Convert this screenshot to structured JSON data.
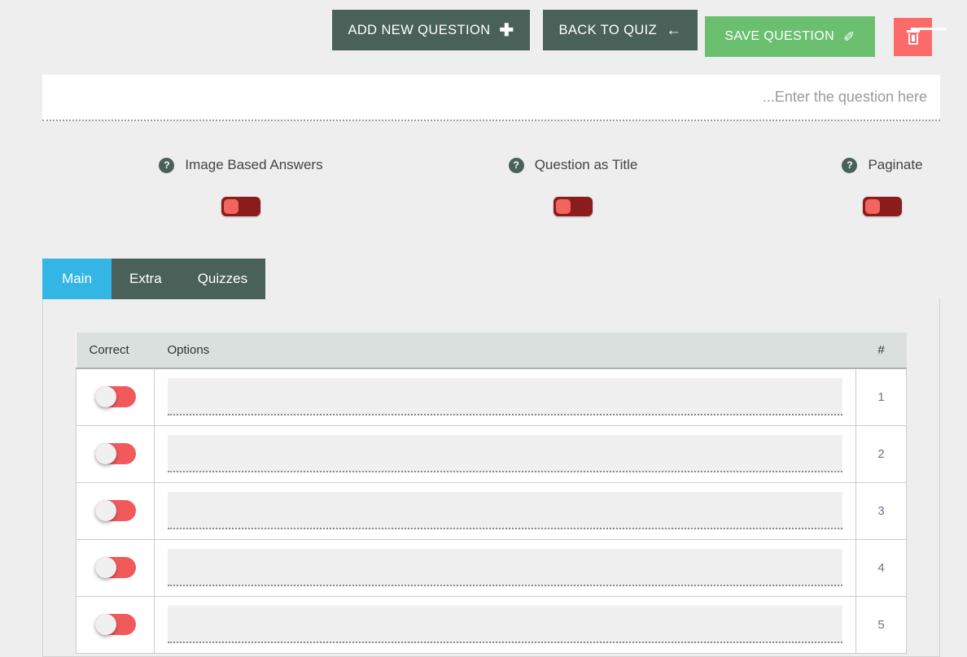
{
  "toolbar": {
    "add_new_question": {
      "label": "ADD NEW QUESTION",
      "icon": "plus-icon",
      "glyph": "✚",
      "color": "#4a615a"
    },
    "back_to_quiz": {
      "label": "BACK TO QUIZ",
      "icon": "arrow-left-icon",
      "glyph": "←",
      "color": "#4a615a"
    },
    "save_question": {
      "label": "SAVE QUESTION",
      "icon": "pin-icon",
      "glyph": "✐",
      "color": "#6bc070"
    },
    "delete_question": {
      "label": "",
      "icon": "trash-icon",
      "color": "#fc6a6a"
    }
  },
  "question": {
    "value": "",
    "placeholder": "...Enter the question here"
  },
  "switches": [
    {
      "label": "Image Based Answers",
      "help_icon": "question-mark-icon",
      "help_glyph": "?",
      "state": "off",
      "track_color": "#8a1c1c",
      "knob_color": "#f2655f"
    },
    {
      "label": "Question as Title",
      "help_icon": "question-mark-icon",
      "help_glyph": "?",
      "state": "off",
      "track_color": "#8a1c1c",
      "knob_color": "#f2655f"
    },
    {
      "label": "Paginate",
      "help_icon": "question-mark-icon",
      "help_glyph": "?",
      "state": "off",
      "track_color": "#8a1c1c",
      "knob_color": "#f2655f"
    }
  ],
  "tabs": [
    {
      "label": "Main",
      "active": true,
      "color": "#33b5e5"
    },
    {
      "label": "Extra",
      "active": false,
      "color": "#4a615a"
    },
    {
      "label": "Quizzes",
      "active": false,
      "color": "#4a615a"
    }
  ],
  "answers_table": {
    "columns": [
      "Correct",
      "Options",
      "#"
    ],
    "rows": [
      {
        "correct": "off",
        "option_value": "",
        "option_placeholder": "",
        "index": "1"
      },
      {
        "correct": "off",
        "option_value": "",
        "option_placeholder": "",
        "index": "2"
      },
      {
        "correct": "off",
        "option_value": "",
        "option_placeholder": "",
        "index": "3"
      },
      {
        "correct": "off",
        "option_value": "",
        "option_placeholder": "",
        "index": "4"
      },
      {
        "correct": "off",
        "option_value": "",
        "option_placeholder": "",
        "index": "5"
      }
    ],
    "toggle_track_color": "#f1595a",
    "toggle_knob_color": "#f0f0f0"
  }
}
